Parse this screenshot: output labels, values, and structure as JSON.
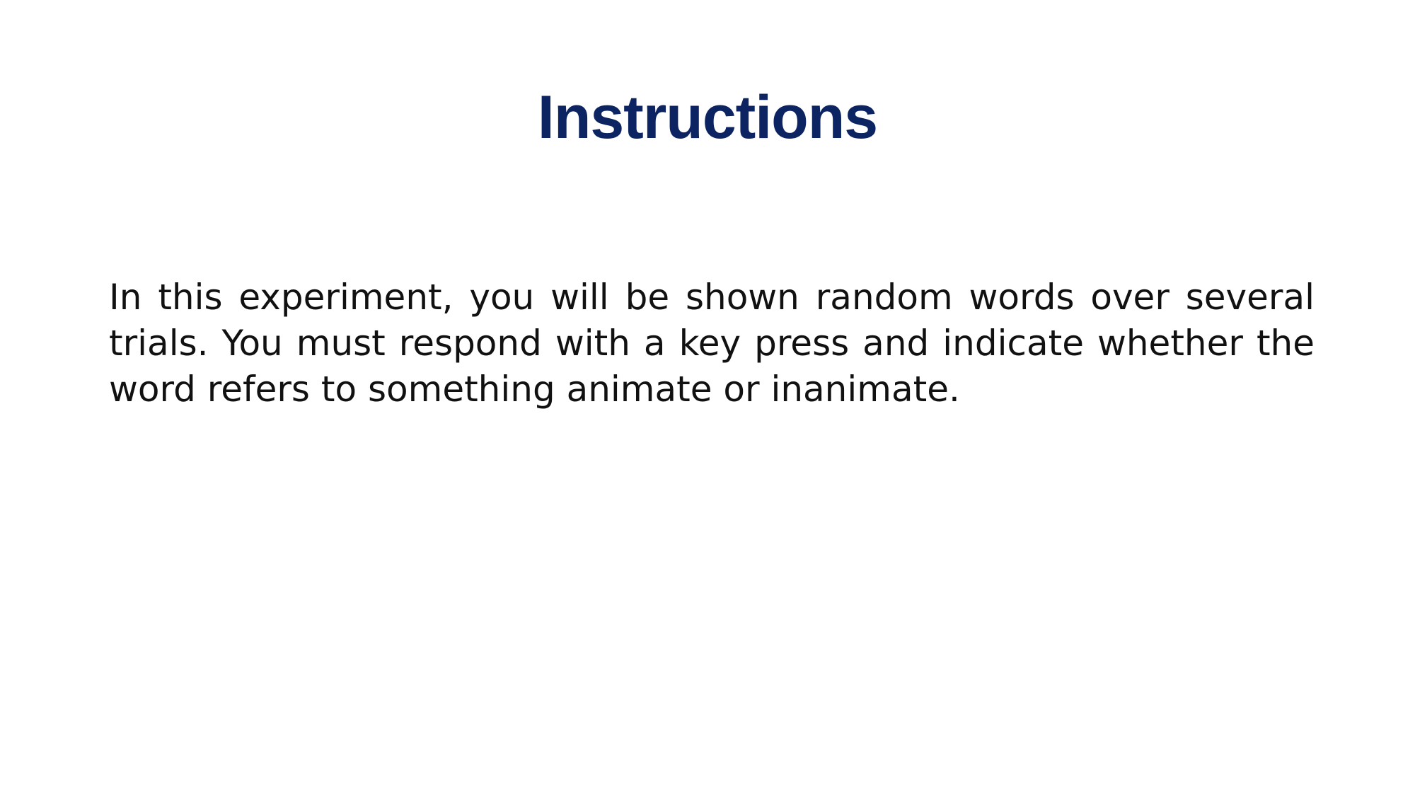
{
  "slide": {
    "title": "Instructions",
    "body": "In this experiment, you will be shown random words over several trials. You must respond with a key press and indicate whether the word refers to something animate or inanimate."
  },
  "colors": {
    "title": "#0c2462",
    "text": "#111111",
    "background": "#ffffff"
  }
}
